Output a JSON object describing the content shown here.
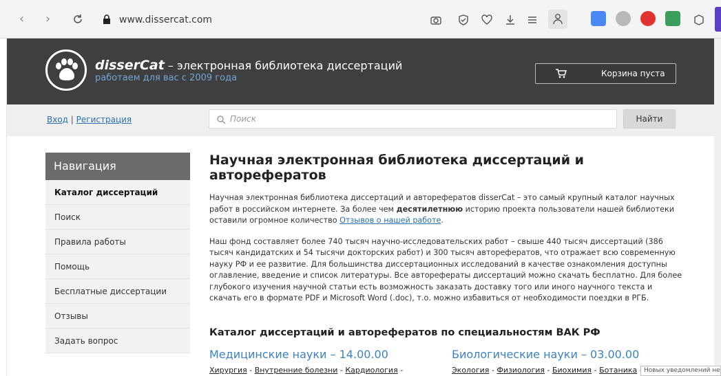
{
  "browser": {
    "url": "www.dissercat.com",
    "back_icon": "chevron-left-icon",
    "forward_icon": "chevron-right-icon",
    "reload_icon": "reload-icon",
    "lock_icon": "lock-icon"
  },
  "header": {
    "brand": "disserCat",
    "tagline_main": " – электронная библиотека диссертаций",
    "tagline_sub": "работаем для вас с 2009 года",
    "cart_label": "Корзина пуста"
  },
  "searchbar": {
    "login": "Вход",
    "separator": " | ",
    "register": "Регистрация",
    "placeholder": "Поиск",
    "submit": "Найти"
  },
  "sidebar": {
    "title": "Навигация",
    "items": [
      {
        "label": "Каталог диссертаций"
      },
      {
        "label": "Поиск"
      },
      {
        "label": "Правила работы"
      },
      {
        "label": "Помощь"
      },
      {
        "label": "Бесплатные диссертации"
      },
      {
        "label": "Отзывы"
      },
      {
        "label": "Задать вопрос"
      }
    ]
  },
  "main": {
    "title": "Научная электронная библиотека диссертаций и авторефератов",
    "p1_a": "Научная электронная библиотека диссертаций и авторефератов disserCat – это самый крупный каталог научных работ в российском интернете. За более чем ",
    "p1_bold": "десятилетнюю",
    "p1_b": " историю проекта пользователи нашей библиотеки оставили огромное количество ",
    "p1_link": "Отзывов о нашей работе",
    "p1_end": ".",
    "p2": "Наш фонд составляет более 740 тысяч научно-исследовательских работ – свыше 440 тысяч диссертаций (386 тысяч кандидатских и 54 тысячи докторских работ) и 300 тысяч авторефератов, что отражает всю современную науку РФ и ее развитие. Для большинства диссертационных исследований в качестве ознакомления доступны оглавление, введение и список литературы. Все авторефераты диссертаций можно скачать бесплатно. Для более глубокого изучения научной статьи есть возможность заказать доставку того или иного научного текста и скачать его в формате PDF и Microsoft Word (.doc), т.о. можно избавиться от необходимости поездки в РГБ.",
    "catalog_title": "Каталог диссертаций и авторефератов по специальностям ВАК РФ",
    "sci_left": "Медицинские науки – 14.00.00",
    "sci_right": "Биологические науки – 03.00.00",
    "left_links": [
      "Хирургия",
      "Внутренние болезни",
      "Кардиология"
    ],
    "right_links": [
      "Экология",
      "Физиология",
      "Биохимия",
      "Ботаника"
    ],
    "link_sep": " - ",
    "notification": "Новых уведомлений не"
  }
}
